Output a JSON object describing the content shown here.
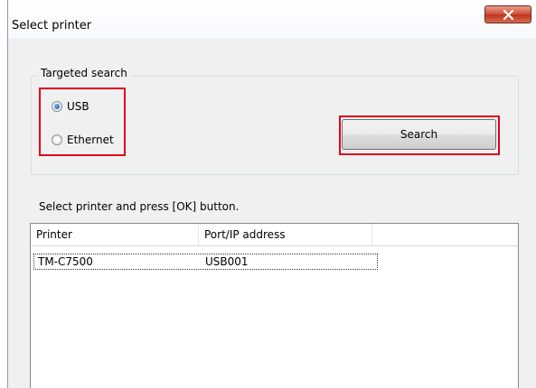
{
  "window": {
    "title": "Select printer",
    "close_glyph": "x"
  },
  "targeted_search": {
    "label": "Targeted search",
    "options": [
      {
        "label": "USB",
        "checked": true
      },
      {
        "label": "Ethernet",
        "checked": false
      }
    ],
    "search_button_label": "Search"
  },
  "instruction": "Select printer and press [OK] button.",
  "printer_list": {
    "columns": [
      "Printer",
      "Port/IP address"
    ],
    "rows": [
      {
        "printer": "TM-C7500",
        "port": "USB001"
      }
    ]
  },
  "colors": {
    "highlight": "#e0001a",
    "window_bg": "#f0f0f0"
  }
}
